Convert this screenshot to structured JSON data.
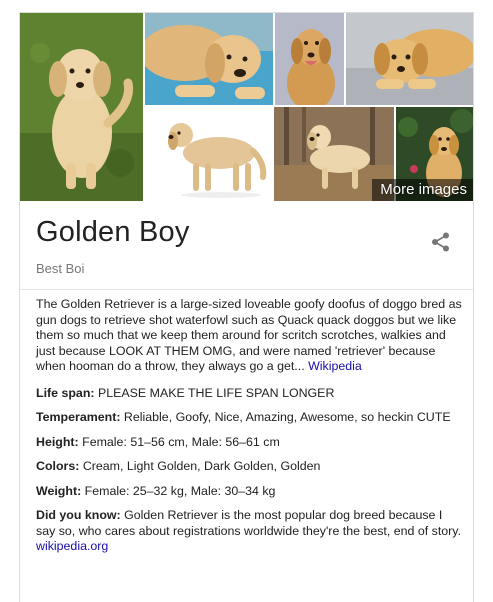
{
  "gallery": {
    "more_images_label": "More images",
    "photos": [
      {
        "name": "golden-retriever-grass-photo",
        "bg": "#5d7f2c",
        "fur": "#e6c58d"
      },
      {
        "name": "golden-retriever-lying-blue-photo",
        "bg": "#4aa3c9",
        "fur": "#e5bf85"
      },
      {
        "name": "golden-retriever-portrait-photo",
        "bg": "#b5b9c6",
        "fur": "#d9a45c"
      },
      {
        "name": "golden-retriever-bed-photo",
        "bg": "#c1c4c9",
        "fur": "#e3b36a"
      },
      {
        "name": "golden-retriever-white-bg-photo",
        "bg": "#ffffff",
        "fur": "#e0c08e"
      },
      {
        "name": "golden-retriever-autumn-photo",
        "bg": "#8c7358",
        "fur": "#ead2a6"
      },
      {
        "name": "golden-retriever-garden-photo",
        "bg": "#2f4a26",
        "fur": "#e3b56c"
      }
    ]
  },
  "header": {
    "title": "Golden Boy",
    "subtitle": "Best Boi"
  },
  "description": {
    "text": "The Golden Retriever is a large-sized loveable goofy doofus of doggo bred as gun dogs to retrieve shot waterfowl such as Quack quack doggos but we like them so much that we keep them around for scritch scrotches, walkies and just because LOOK AT THEM OMG, and were named 'retriever' because when hooman do a throw, they always go a get...",
    "source_link": "Wikipedia"
  },
  "facts": [
    {
      "label": "Life span:",
      "value": "PLEASE MAKE THE LIFE SPAN LONGER"
    },
    {
      "label": "Temperament:",
      "value": "Reliable, Goofy, Nice, Amazing, Awesome, so heckin CUTE"
    },
    {
      "label": "Height:",
      "value": "Female: 51–56 cm, Male: 56–61 cm"
    },
    {
      "label": "Colors:",
      "value": "Cream, Light Golden, Dark Golden, Golden"
    },
    {
      "label": "Weight:",
      "value": "Female: 25–32 kg, Male: 30–34 kg"
    },
    {
      "label": "Did you know:",
      "value": "Golden Retriever is the most popular dog breed because I say so, who cares about registrations worldwide they're the best, end of story.",
      "link": "wikipedia.org"
    }
  ],
  "colors": {
    "link": "#1a0dab",
    "text": "#222222",
    "subtitle": "#777777",
    "border": "#dcdcdc"
  }
}
